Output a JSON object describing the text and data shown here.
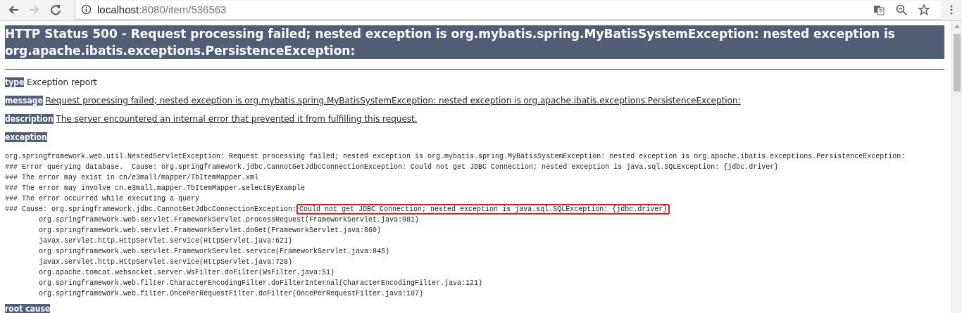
{
  "browser": {
    "back_enabled": true,
    "forward_enabled": false,
    "url_host": "localhost",
    "url_path": ":8080/item/536563"
  },
  "title": "HTTP Status 500 - Request processing failed; nested exception is org.mybatis.spring.MyBatisSystemException: nested exception is org.apache.ibatis.exceptions.PersistenceException:",
  "fields": [
    {
      "label": "type",
      "value": "Exception report",
      "underlined": false
    },
    {
      "label": "message",
      "value": "Request processing failed; nested exception is org.mybatis.spring.MyBatisSystemException: nested exception is org.apache.ibatis.exceptions.PersistenceException:",
      "underlined": true
    },
    {
      "label": "description",
      "value": "The server encountered an internal error that prevented it from fulfilling this request.",
      "underlined": true
    }
  ],
  "exception": {
    "label": "exception",
    "lines": [
      {
        "kind": "line",
        "text": "org.springframework.web.util.NestedServletException: Request processing failed; nested exception is org.mybatis.spring.MyBatisSystemException: nested exception is org.apache.ibatis.exceptions.PersistenceException:"
      },
      {
        "kind": "line",
        "text": "### Error querying database.  Cause: org.springframework.jdbc.CannotGetJdbcConnectionException: Could not get JDBC Connection; nested exception is java.sql.SQLException: {jdbc.driver}"
      },
      {
        "kind": "line",
        "text": "### The error may exist in cn/e3mall/mapper/TbItemMapper.xml"
      },
      {
        "kind": "line",
        "text": "### The error may involve cn.e3mall.mapper.TbItemMapper.selectByExample"
      },
      {
        "kind": "line",
        "text": "### The error occurred while executing a query"
      },
      {
        "kind": "line",
        "text": "### Cause: org.springframework.jdbc.CannotGetJdbcConnectionException:",
        "highlight": "Could not get JDBC Connection; nested exception is java.sql.SQLException: {jdbc.driver}"
      },
      {
        "kind": "frame",
        "text": "org.springframework.web.servlet.FrameworkServlet.processRequest(FrameworkServlet.java:981)"
      },
      {
        "kind": "frame",
        "text": "org.springframework.web.servlet.FrameworkServlet.doGet(FrameworkServlet.java:860)"
      },
      {
        "kind": "frame",
        "text": "javax.servlet.http.HttpServlet.service(HttpServlet.java:621)"
      },
      {
        "kind": "frame",
        "text": "org.springframework.web.servlet.FrameworkServlet.service(FrameworkServlet.java:845)"
      },
      {
        "kind": "frame",
        "text": "javax.servlet.http.HttpServlet.service(HttpServlet.java:728)"
      },
      {
        "kind": "frame",
        "text": "org.apache.tomcat.websocket.server.WsFilter.doFilter(WsFilter.java:51)"
      },
      {
        "kind": "frame",
        "text": "org.springframework.web.filter.CharacterEncodingFilter.doFilterInternal(CharacterEncodingFilter.java:121)"
      },
      {
        "kind": "frame",
        "text": "org.springframework.web.filter.OncePerRequestFilter.doFilter(OncePerRequestFilter.java:107)"
      }
    ]
  },
  "root_cause": {
    "label": "root cause"
  }
}
